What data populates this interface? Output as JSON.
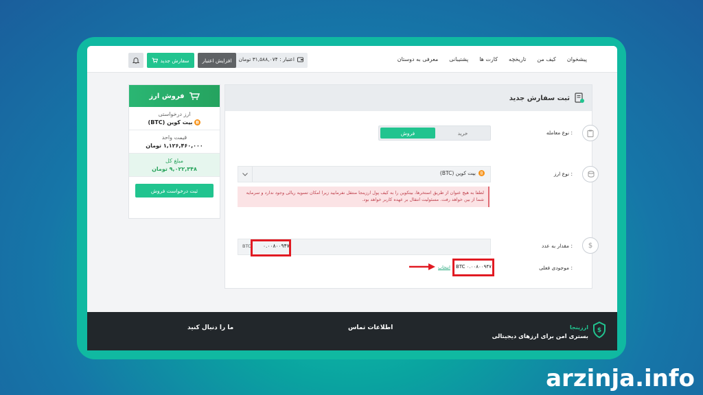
{
  "nav": {
    "items": [
      "پیشخوان",
      "کیف من",
      "تاریخچه",
      "کارت ها",
      "پشتیبانی",
      "معرفی به دوستان"
    ],
    "credit_label": "اعتبار : ۳۱,۵۸۸,۰۷۴ تومان",
    "credit_button": "افزایش اعتبار",
    "new_order_button": "سفارش جدید"
  },
  "sidebar": {
    "title": "فروش ارز",
    "currency_label": "ارز درخواستی",
    "currency_value": "بیت کوین (BTC)",
    "unit_price_label": "قیمت واحد",
    "unit_price_value": "۱,۱۲۶,۴۶۰,۰۰۰ تومان",
    "total_label": "مبلغ کل",
    "total_value": "۹,۰۲۲,۳۴۸ تومان",
    "submit_button": "ثبت درخواست فروش"
  },
  "main": {
    "title": "ثبت سفارش جدید",
    "trade_type_label": "نوع معامله :",
    "trade_buy": "خرید",
    "trade_sell": "فروش",
    "currency_type_label": "نوع ارز :",
    "currency_selected": "بیت کوین (BTC)",
    "alert_text": "لطفا به هیچ عنوان از طریق استخرها، بیتکوین را به کیف پول ارزینجا منتقل نفرمایید زیرا امکان تسویه ریالی وجود ندارد و سرمایه شما از بین خواهد رفت. مسئولیت انتقال بر عهده کاربر خواهد بود.",
    "amount_label": "مقدار به عدد :",
    "amount_unit": "BTC",
    "amount_value": "۰.۰۰۸۰۰۹۴۷",
    "balance_label": "موجودی فعلی :",
    "balance_value": "BTC ۰.۰۰۸۰۰۹۴۷",
    "balance_link": "انتخاب"
  },
  "footer": {
    "follow": "ما را دنبال کنید",
    "contact": "اطلاعات تماس",
    "brand_name": "ارزینجا",
    "brand_tagline": "بستری امن برای ارزهای دیجیتالی"
  },
  "watermark": "arzinja.info",
  "colors": {
    "accent": "#21c48f",
    "highlight": "#e11a22",
    "footer": "#22272b"
  }
}
